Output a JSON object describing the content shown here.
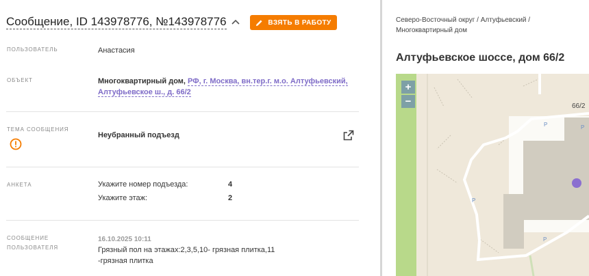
{
  "header": {
    "title": "Сообщение, ID 143978776, №143978776",
    "take_button_label": "ВЗЯТЬ В РАБОТУ"
  },
  "fields": {
    "user": {
      "label": "ПОЛЬЗОВАТЕЛЬ",
      "value": "Анастасия"
    },
    "object": {
      "label": "ОБЪЕКТ",
      "type": "Многоквартирный дом,",
      "address_line1": "РФ, г. Москва, вн.тер.г. м.о. Алтуфьевский,",
      "address_line2": "Алтуфьевское ш., д. 66/2"
    },
    "topic": {
      "label": "ТЕМА СООБЩЕНИЯ",
      "value": "Неубранный подъезд"
    },
    "survey": {
      "label": "АНКЕТА",
      "rows": [
        {
          "question": "Укажите номер подъезда:",
          "answer": "4"
        },
        {
          "question": "Укажите этаж:",
          "answer": "2"
        }
      ]
    },
    "user_message": {
      "label_line1": "СООБЩЕНИЕ",
      "label_line2": "ПОЛЬЗОВАТЕЛЯ",
      "timestamp": "16.10.2025 10:11",
      "text_line1": "Грязный пол на этажах:2,3,5,10- грязная плитка,11",
      "text_line2": "-грязная плитка"
    }
  },
  "location": {
    "breadcrumb_line1": "Северо-Восточный округ / Алтуфьевский /",
    "breadcrumb_line2": "Многоквартирный дом",
    "address_title": "Алтуфьевское шоссе, дом 66/2",
    "map": {
      "zoom_in": "+",
      "zoom_out": "−",
      "building_label": "66/2",
      "parking_symbol": "P"
    }
  },
  "colors": {
    "accent": "#f57c00",
    "link": "#7e6bc7",
    "marker": "#8b6fd0"
  },
  "icons": [
    "chevron-up-icon",
    "pencil-icon",
    "warning-icon",
    "external-link-icon"
  ]
}
